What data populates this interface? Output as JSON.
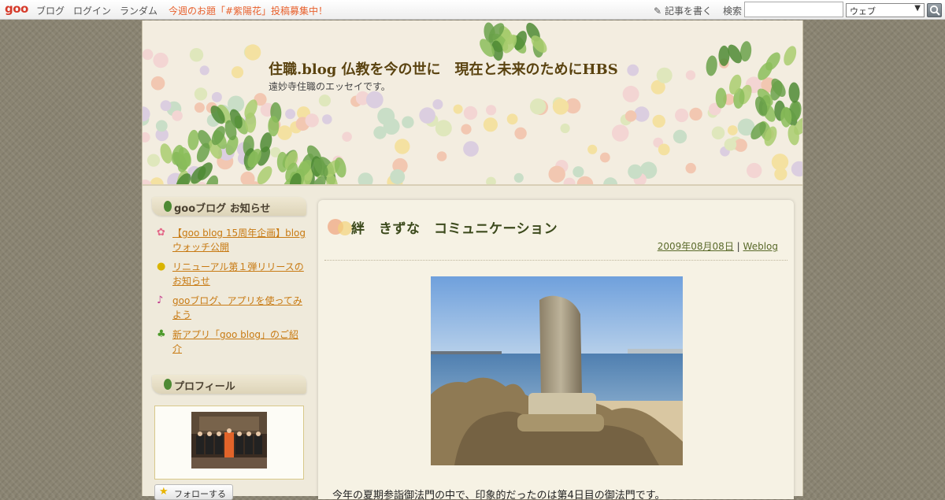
{
  "topbar": {
    "logo": "goo",
    "nav": [
      "ブログ",
      "ログイン",
      "ランダム"
    ],
    "promo": "今週のお題「#紫陽花」投稿募集中！",
    "write_label": "記事を書く",
    "search_label": "検索",
    "search_value": "",
    "search_scope": "ウェブ"
  },
  "header": {
    "title": "住職.blog 仏教を今の世に　現在と未来のためにHBS",
    "subtitle": "遠妙寺住職のエッセイです。"
  },
  "sidebar": {
    "news_heading": "gooブログ お知らせ",
    "news_items": [
      {
        "label": "【goo blog 15周年企画】blogウォッチ公開",
        "icon": "flower-icon"
      },
      {
        "label": "リニューアル第１弾リリースのお知らせ",
        "icon": "lightbulb-icon"
      },
      {
        "label": "gooブログ、アプリを使ってみよう",
        "icon": "music-note-icon"
      },
      {
        "label": "新アプリ「goo blog」のご紹介",
        "icon": "clover-icon"
      }
    ],
    "profile_heading": "プロフィール",
    "follow_label": "フォローする"
  },
  "entry": {
    "title": "絆　きずな　コミュニケーション",
    "date": "2009年08月08日",
    "separator": "|",
    "category": "Weblog",
    "text": "今年の夏期参詣御法門の中で、印象的だったのは第4日目の御法門です。"
  },
  "colors": {
    "accent": "#c87a12",
    "title": "#5a4310",
    "promo": "#e8602c"
  }
}
